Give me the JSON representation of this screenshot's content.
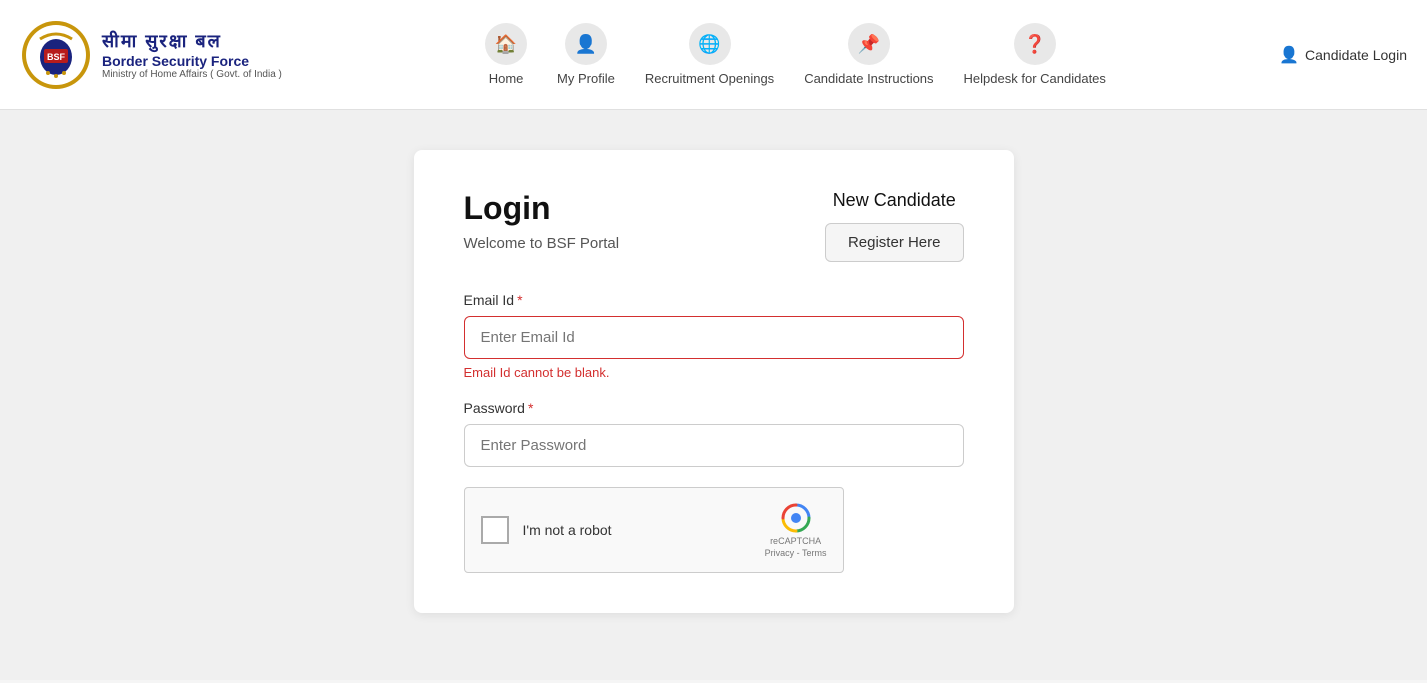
{
  "header": {
    "logo": {
      "hindi_text": "सीमा सुरक्षा बल",
      "english_text": "Border Security Force",
      "sub_text": "Ministry of Home Affairs ( Govt. of India )"
    },
    "nav": [
      {
        "id": "home",
        "label": "Home",
        "icon": "🏠"
      },
      {
        "id": "my-profile",
        "label": "My Profile",
        "icon": "👤"
      },
      {
        "id": "recruitment-openings",
        "label": "Recruitment Openings",
        "icon": "🌐"
      },
      {
        "id": "candidate-instructions",
        "label": "Candidate Instructions",
        "icon": "📌"
      },
      {
        "id": "helpdesk",
        "label": "Helpdesk for Candidates",
        "icon": "❓"
      }
    ],
    "candidate_login_label": "Candidate Login"
  },
  "login_card": {
    "title": "Login",
    "subtitle": "Welcome to BSF Portal",
    "new_candidate_label": "New Candidate",
    "register_btn_label": "Register Here",
    "email_label": "Email Id",
    "email_placeholder": "Enter Email Id",
    "email_error": "Email Id cannot be blank.",
    "password_label": "Password",
    "password_placeholder": "Enter Password",
    "recaptcha_label": "I'm not a robot",
    "recaptcha_sub": "reCAPTCHA",
    "recaptcha_sub2": "Privacy - Terms"
  }
}
